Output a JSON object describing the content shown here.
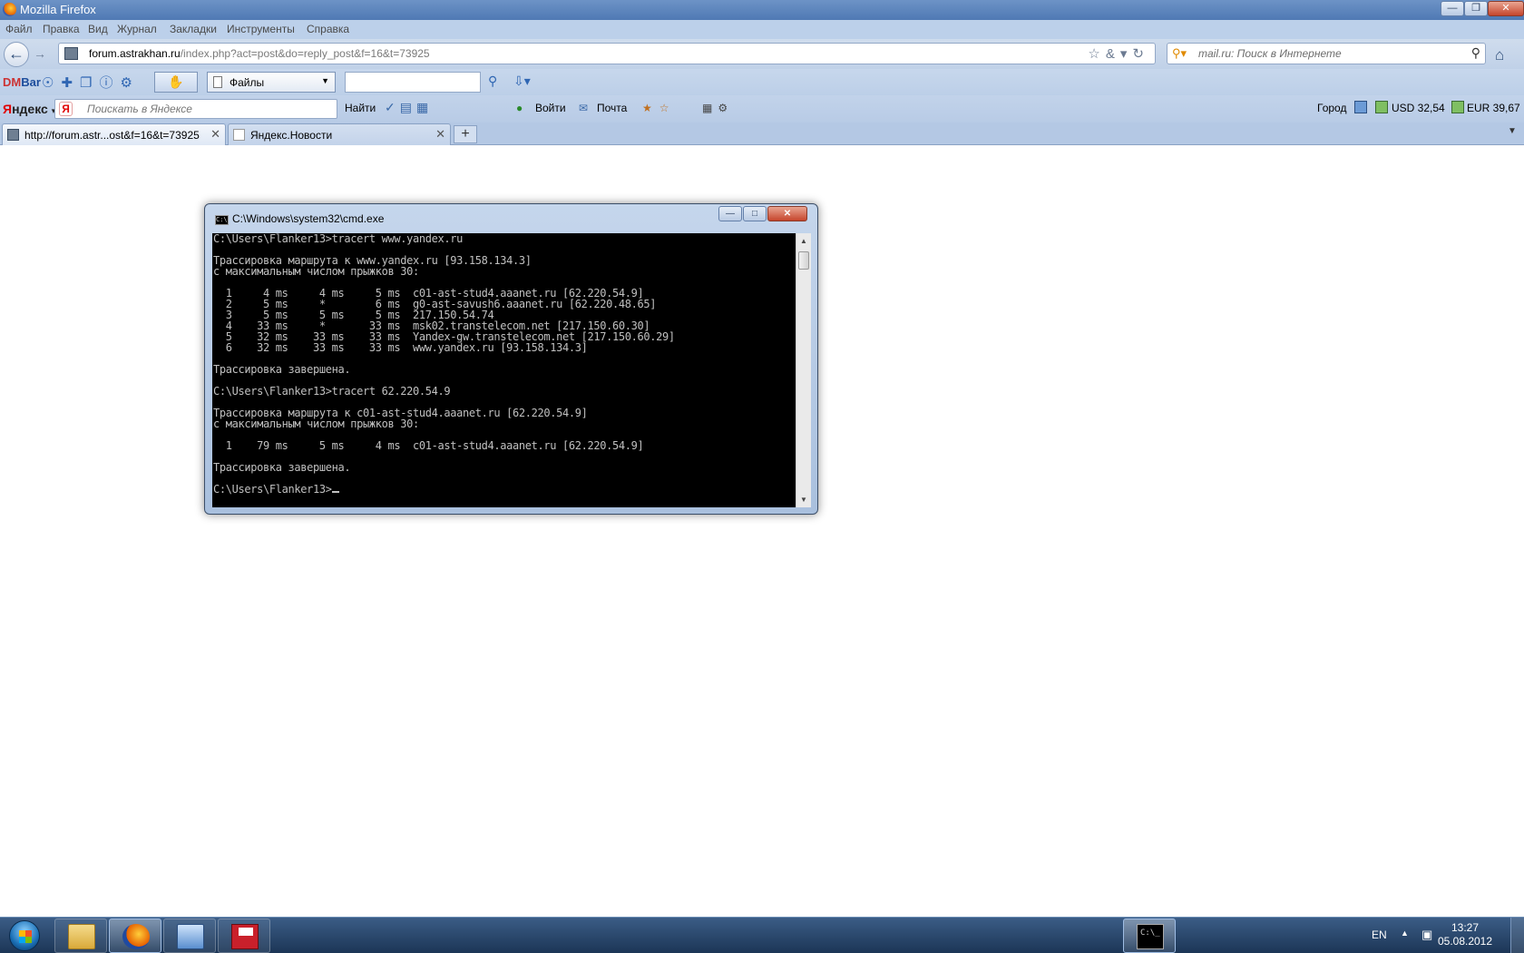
{
  "browser": {
    "title": "Mozilla Firefox",
    "menu": [
      "Файл",
      "Правка",
      "Вид",
      "Журнал",
      "Закладки",
      "Инструменты",
      "Справка"
    ],
    "url_domain": "forum.astrakhan.ru",
    "url_path": "/index.php?act=post&do=reply_post&f=16&t=73925",
    "search_placeholder": "mail.ru: Поиск в Интернете",
    "dmbar": {
      "dm": "DM",
      "bar": "Bar",
      "files_label": "Файлы"
    },
    "yandex": {
      "logo_first": "Я",
      "logo_rest": "ндекс",
      "search_placeholder": "Поискать в Яндексе",
      "find_label": "Найти",
      "login_label": "Войти",
      "mail_label": "Почта",
      "city_label": "Город",
      "usd_label": "USD 32,54",
      "eur_label": "EUR 39,67"
    },
    "tabs": [
      {
        "label": "http://forum.astr...ost&f=16&t=73925",
        "active": true
      },
      {
        "label": "Яндекс.Новости",
        "active": false
      }
    ],
    "new_tab_label": "+"
  },
  "cmd": {
    "title": "C:\\Windows\\system32\\cmd.exe",
    "lines": [
      "C:\\Users\\Flanker13>tracert www.yandex.ru",
      "",
      "Трассировка маршрута к www.yandex.ru [93.158.134.3]",
      "с максимальным числом прыжков 30:",
      "",
      "  1     4 ms     4 ms     5 ms  c01-ast-stud4.aaanet.ru [62.220.54.9]",
      "  2     5 ms     *        6 ms  g0-ast-savush6.aaanet.ru [62.220.48.65]",
      "  3     5 ms     5 ms     5 ms  217.150.54.74",
      "  4    33 ms     *       33 ms  msk02.transtelecom.net [217.150.60.30]",
      "  5    32 ms    33 ms    33 ms  Yandex-gw.transtelecom.net [217.150.60.29]",
      "  6    32 ms    33 ms    33 ms  www.yandex.ru [93.158.134.3]",
      "",
      "Трассировка завершена.",
      "",
      "C:\\Users\\Flanker13>tracert 62.220.54.9",
      "",
      "Трассировка маршрута к c01-ast-stud4.aaanet.ru [62.220.54.9]",
      "с максимальным числом прыжков 30:",
      "",
      "  1    79 ms     5 ms     4 ms  c01-ast-stud4.aaanet.ru [62.220.54.9]",
      "",
      "Трассировка завершена.",
      ""
    ],
    "prompt": "C:\\Users\\Flanker13>"
  },
  "taskbar": {
    "language": "EN",
    "time": "13:27",
    "date": "05.08.2012"
  },
  "icons": {
    "back": "arrow-left",
    "forward": "arrow-right",
    "reload": "reload",
    "bookmark": "star",
    "home": "house",
    "search": "magnifier"
  }
}
